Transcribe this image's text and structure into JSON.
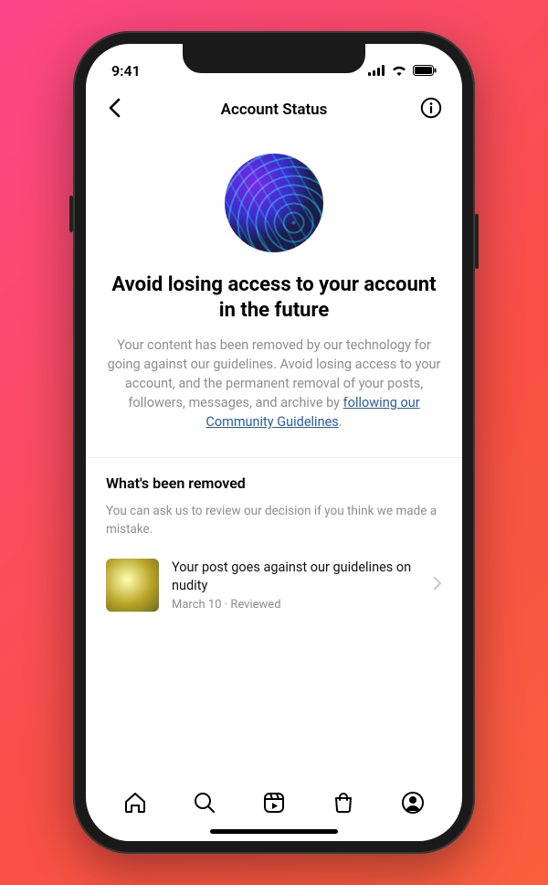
{
  "status_bar": {
    "time": "9:41"
  },
  "header": {
    "title": "Account Status"
  },
  "hero": {
    "headline": "Avoid losing access to your account in the future",
    "body_pre": "Your content has been removed by our technology for going against our guidelines. Avoid losing access to your account, and the permanent removal of your posts, followers, messages, and archive by ",
    "link_text": "following our Community Guidelines"
  },
  "removed": {
    "section_title": "What's been removed",
    "section_sub": "You can ask us to review our decision if you think we made a mistake.",
    "items": [
      {
        "title": "Your post goes against our guidelines on nudity",
        "meta": "March 10 · Reviewed"
      }
    ]
  }
}
